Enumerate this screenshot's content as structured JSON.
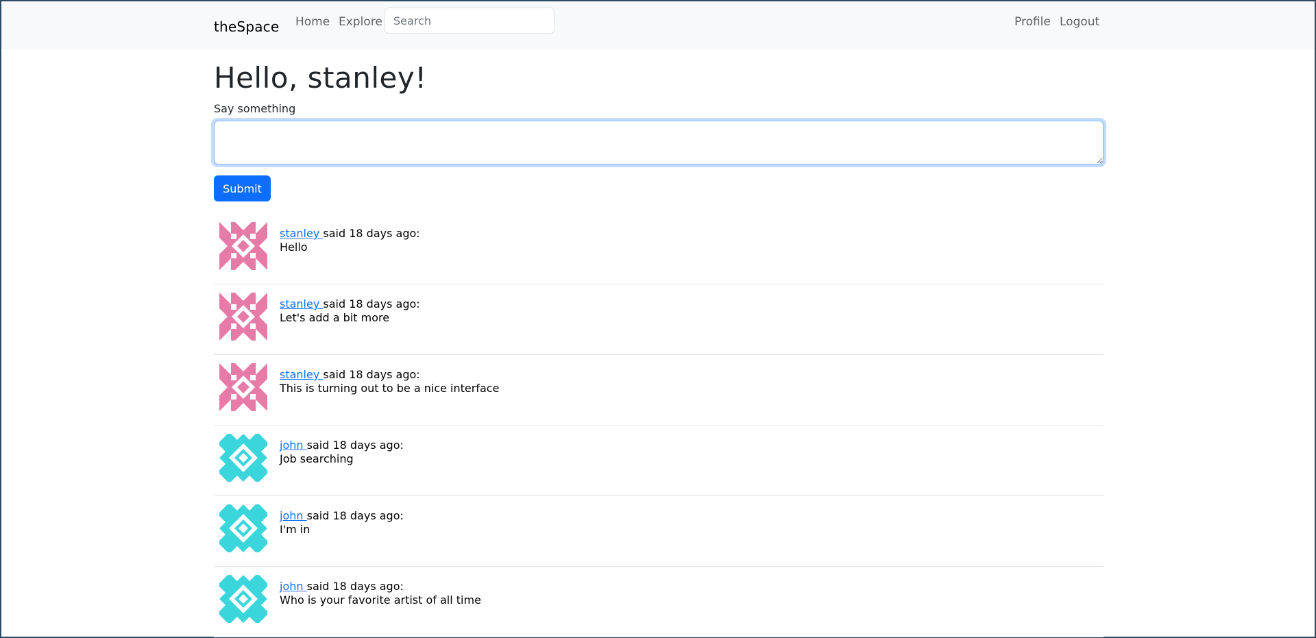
{
  "navbar": {
    "brand": "theSpace",
    "links": {
      "home": "Home",
      "explore": "Explore",
      "profile": "Profile",
      "logout": "Logout"
    },
    "search": {
      "placeholder": "Search",
      "value": ""
    }
  },
  "main": {
    "greeting": "Hello, stanley!",
    "form": {
      "label": "Say something",
      "value": "",
      "submit_label": "Submit"
    }
  },
  "posts": [
    {
      "author": "stanley ",
      "meta": "said 18 days ago:",
      "body": "Hello",
      "avatar": "identicon-pink"
    },
    {
      "author": "stanley ",
      "meta": "said 18 days ago:",
      "body": "Let's add a bit more",
      "avatar": "identicon-pink"
    },
    {
      "author": "stanley ",
      "meta": "said 18 days ago:",
      "body": "This is turning out to be a nice interface",
      "avatar": "identicon-pink"
    },
    {
      "author": "john ",
      "meta": "said 18 days ago:",
      "body": "Job searching",
      "avatar": "identicon-cyan"
    },
    {
      "author": "john ",
      "meta": "said 18 days ago:",
      "body": "I'm in",
      "avatar": "identicon-cyan"
    },
    {
      "author": "john ",
      "meta": "said 18 days ago:",
      "body": "Who is your favorite artist of all time",
      "avatar": "identicon-cyan"
    }
  ],
  "colors": {
    "accent": "#0d6efd",
    "pink_identicon": "#e77ba8",
    "cyan_identicon": "#3ad6dc",
    "navbar_bg": "#f8f9fa"
  }
}
